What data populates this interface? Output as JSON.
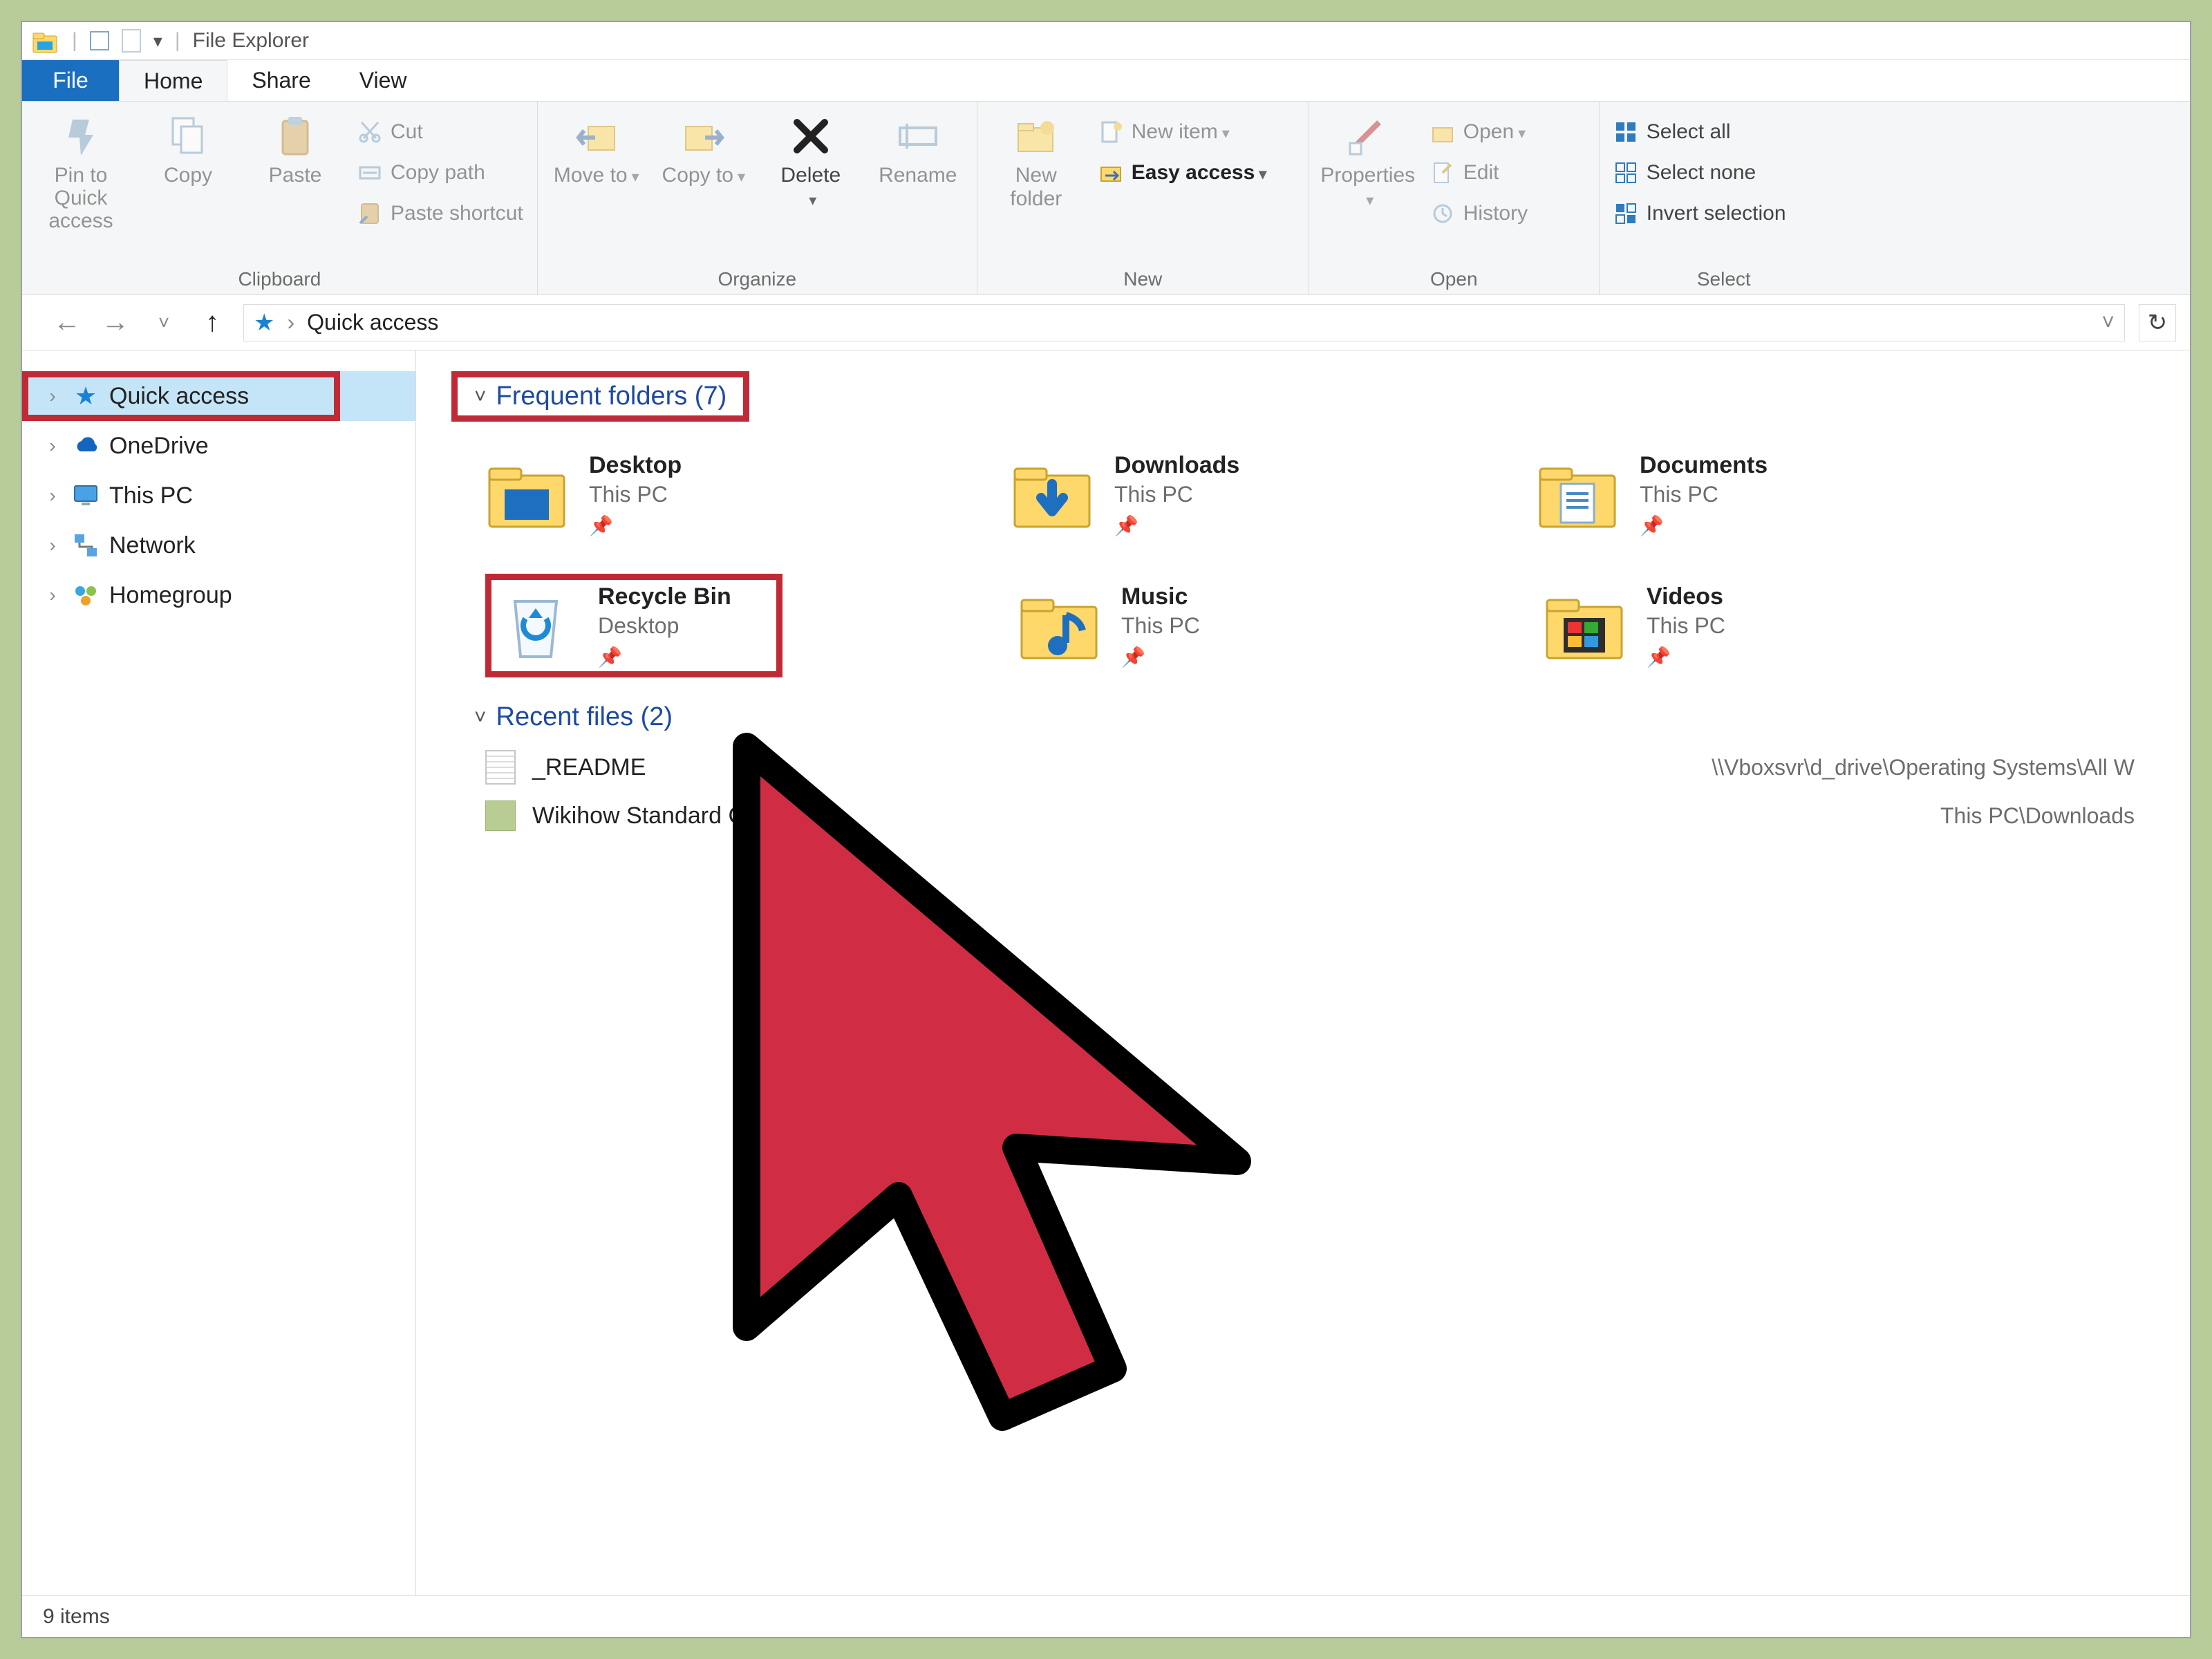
{
  "window": {
    "title": "File Explorer"
  },
  "tabs": {
    "file": "File",
    "home": "Home",
    "share": "Share",
    "view": "View"
  },
  "ribbon": {
    "clipboard": {
      "label": "Clipboard",
      "pin": "Pin to Quick access",
      "copy": "Copy",
      "paste": "Paste",
      "cut": "Cut",
      "copy_path": "Copy path",
      "paste_shortcut": "Paste shortcut"
    },
    "organize": {
      "label": "Organize",
      "move_to": "Move to",
      "copy_to": "Copy to",
      "delete": "Delete",
      "rename": "Rename"
    },
    "new": {
      "label": "New",
      "new_folder": "New folder",
      "new_item": "New item",
      "easy_access": "Easy access"
    },
    "open": {
      "label": "Open",
      "properties": "Properties",
      "open": "Open",
      "edit": "Edit",
      "history": "History"
    },
    "select": {
      "label": "Select",
      "select_all": "Select all",
      "select_none": "Select none",
      "invert": "Invert selection"
    }
  },
  "address": {
    "location": "Quick access"
  },
  "navpane": {
    "items": [
      {
        "label": "Quick access",
        "icon": "star"
      },
      {
        "label": "OneDrive",
        "icon": "cloud"
      },
      {
        "label": "This PC",
        "icon": "monitor"
      },
      {
        "label": "Network",
        "icon": "network"
      },
      {
        "label": "Homegroup",
        "icon": "homegroup"
      }
    ]
  },
  "content": {
    "frequent_header": "Frequent folders (7)",
    "recent_header": "Recent files (2)",
    "folders": [
      {
        "name": "Desktop",
        "loc": "This PC",
        "icon": "desktop"
      },
      {
        "name": "Downloads",
        "loc": "This PC",
        "icon": "downloads"
      },
      {
        "name": "Documents",
        "loc": "This PC",
        "icon": "documents"
      },
      {
        "name": "Recycle Bin",
        "loc": "Desktop",
        "icon": "recycle"
      },
      {
        "name": "Music",
        "loc": "This PC",
        "icon": "music"
      },
      {
        "name": "Videos",
        "loc": "This PC",
        "icon": "videos"
      }
    ],
    "recent_files": [
      {
        "name": "_README",
        "path": "\\\\Vboxsvr\\d_drive\\Operating Systems\\All W",
        "icon": "text"
      },
      {
        "name": "Wikihow Standard Gr",
        "path": "This PC\\Downloads",
        "icon": "green"
      }
    ]
  },
  "status": {
    "items": "9 items"
  }
}
